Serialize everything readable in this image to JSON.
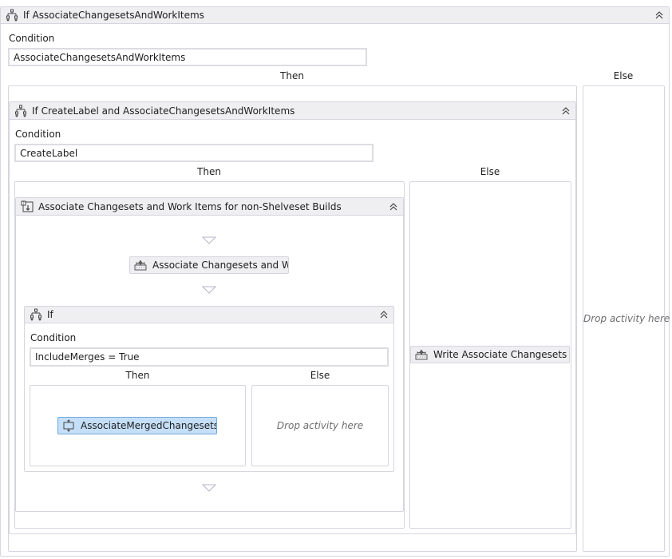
{
  "outer_if": {
    "title": "If AssociateChangesetsAndWorkItems",
    "condition_label": "Condition",
    "condition_value": "AssociateChangesetsAndWorkItems",
    "then_label": "Then",
    "else_label": "Else",
    "else_placeholder": "Drop activity here"
  },
  "inner_if": {
    "title": "If CreateLabel and AssociateChangesetsAndWorkItems",
    "condition_label": "Condition",
    "condition_value": "CreateLabel",
    "then_label": "Then",
    "else_label": "Else",
    "else_activity": "Write Associate Changesets"
  },
  "sequence": {
    "title": "Associate Changesets and Work Items for non-Shelveset Builds",
    "activity": "Associate Changesets and Work Items"
  },
  "nested_if": {
    "title": "If",
    "condition_label": "Condition",
    "condition_value": "IncludeMerges = True",
    "then_label": "Then",
    "else_label": "Else",
    "then_activity": "AssociateMergedChangesets",
    "else_placeholder": "Drop activity here"
  },
  "colors": {
    "header_bg": "#efeff2",
    "border": "#d5d5df",
    "selected_bg": "#c5dff8",
    "selected_border": "#6fa8dc"
  }
}
